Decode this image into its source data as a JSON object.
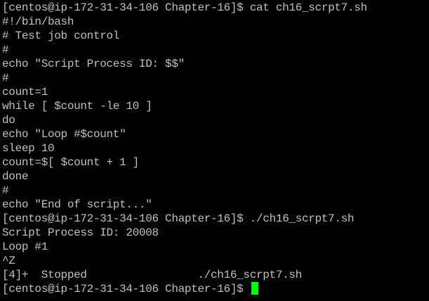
{
  "terminal": {
    "lines": [
      "[centos@ip-172-31-34-106 Chapter-16]$ cat ch16_scrpt7.sh",
      "#!/bin/bash",
      "# Test job control",
      "#",
      "echo \"Script Process ID: $$\"",
      "#",
      "count=1",
      "while [ $count -le 10 ]",
      "do",
      "echo \"Loop #$count\"",
      "sleep 10",
      "count=$[ $count + 1 ]",
      "done",
      "#",
      "echo \"End of script...\"",
      "[centos@ip-172-31-34-106 Chapter-16]$ ./ch16_scrpt7.sh",
      "Script Process ID: 20008",
      "Loop #1",
      "^Z",
      "[4]+  Stopped                 ./ch16_scrpt7.sh"
    ],
    "prompt": "[centos@ip-172-31-34-106 Chapter-16]$ ",
    "text_color": "#c0c0c0",
    "background_color": "#000000",
    "cursor_color": "#00ff00"
  }
}
